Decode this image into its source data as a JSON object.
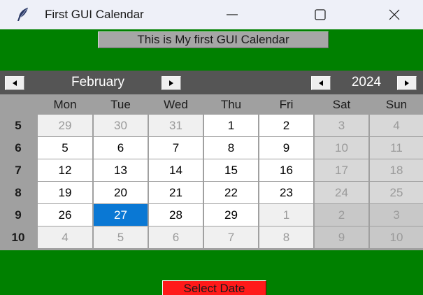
{
  "window": {
    "title": "First GUI Calendar",
    "icon": "feather-icon",
    "background_color": "#008000"
  },
  "header": {
    "label": "This is My first GUI Calendar"
  },
  "calendar": {
    "month": "February",
    "year": "2024",
    "days_of_week": [
      "Mon",
      "Tue",
      "Wed",
      "Thu",
      "Fri",
      "Sat",
      "Sun"
    ],
    "weeks": [
      {
        "week": "5",
        "days": [
          "29",
          "30",
          "31",
          "1",
          "2",
          "3",
          "4"
        ]
      },
      {
        "week": "6",
        "days": [
          "5",
          "6",
          "7",
          "8",
          "9",
          "10",
          "11"
        ]
      },
      {
        "week": "7",
        "days": [
          "12",
          "13",
          "14",
          "15",
          "16",
          "17",
          "18"
        ]
      },
      {
        "week": "8",
        "days": [
          "19",
          "20",
          "21",
          "22",
          "23",
          "24",
          "25"
        ]
      },
      {
        "week": "9",
        "days": [
          "26",
          "27",
          "28",
          "29",
          "1",
          "2",
          "3"
        ]
      },
      {
        "week": "10",
        "days": [
          "4",
          "5",
          "6",
          "7",
          "8",
          "9",
          "10"
        ]
      }
    ],
    "selected_date": "27",
    "selected_color": "#0a78d4"
  },
  "select_button": {
    "label": "Select Date",
    "color": "#ff1a1a"
  }
}
